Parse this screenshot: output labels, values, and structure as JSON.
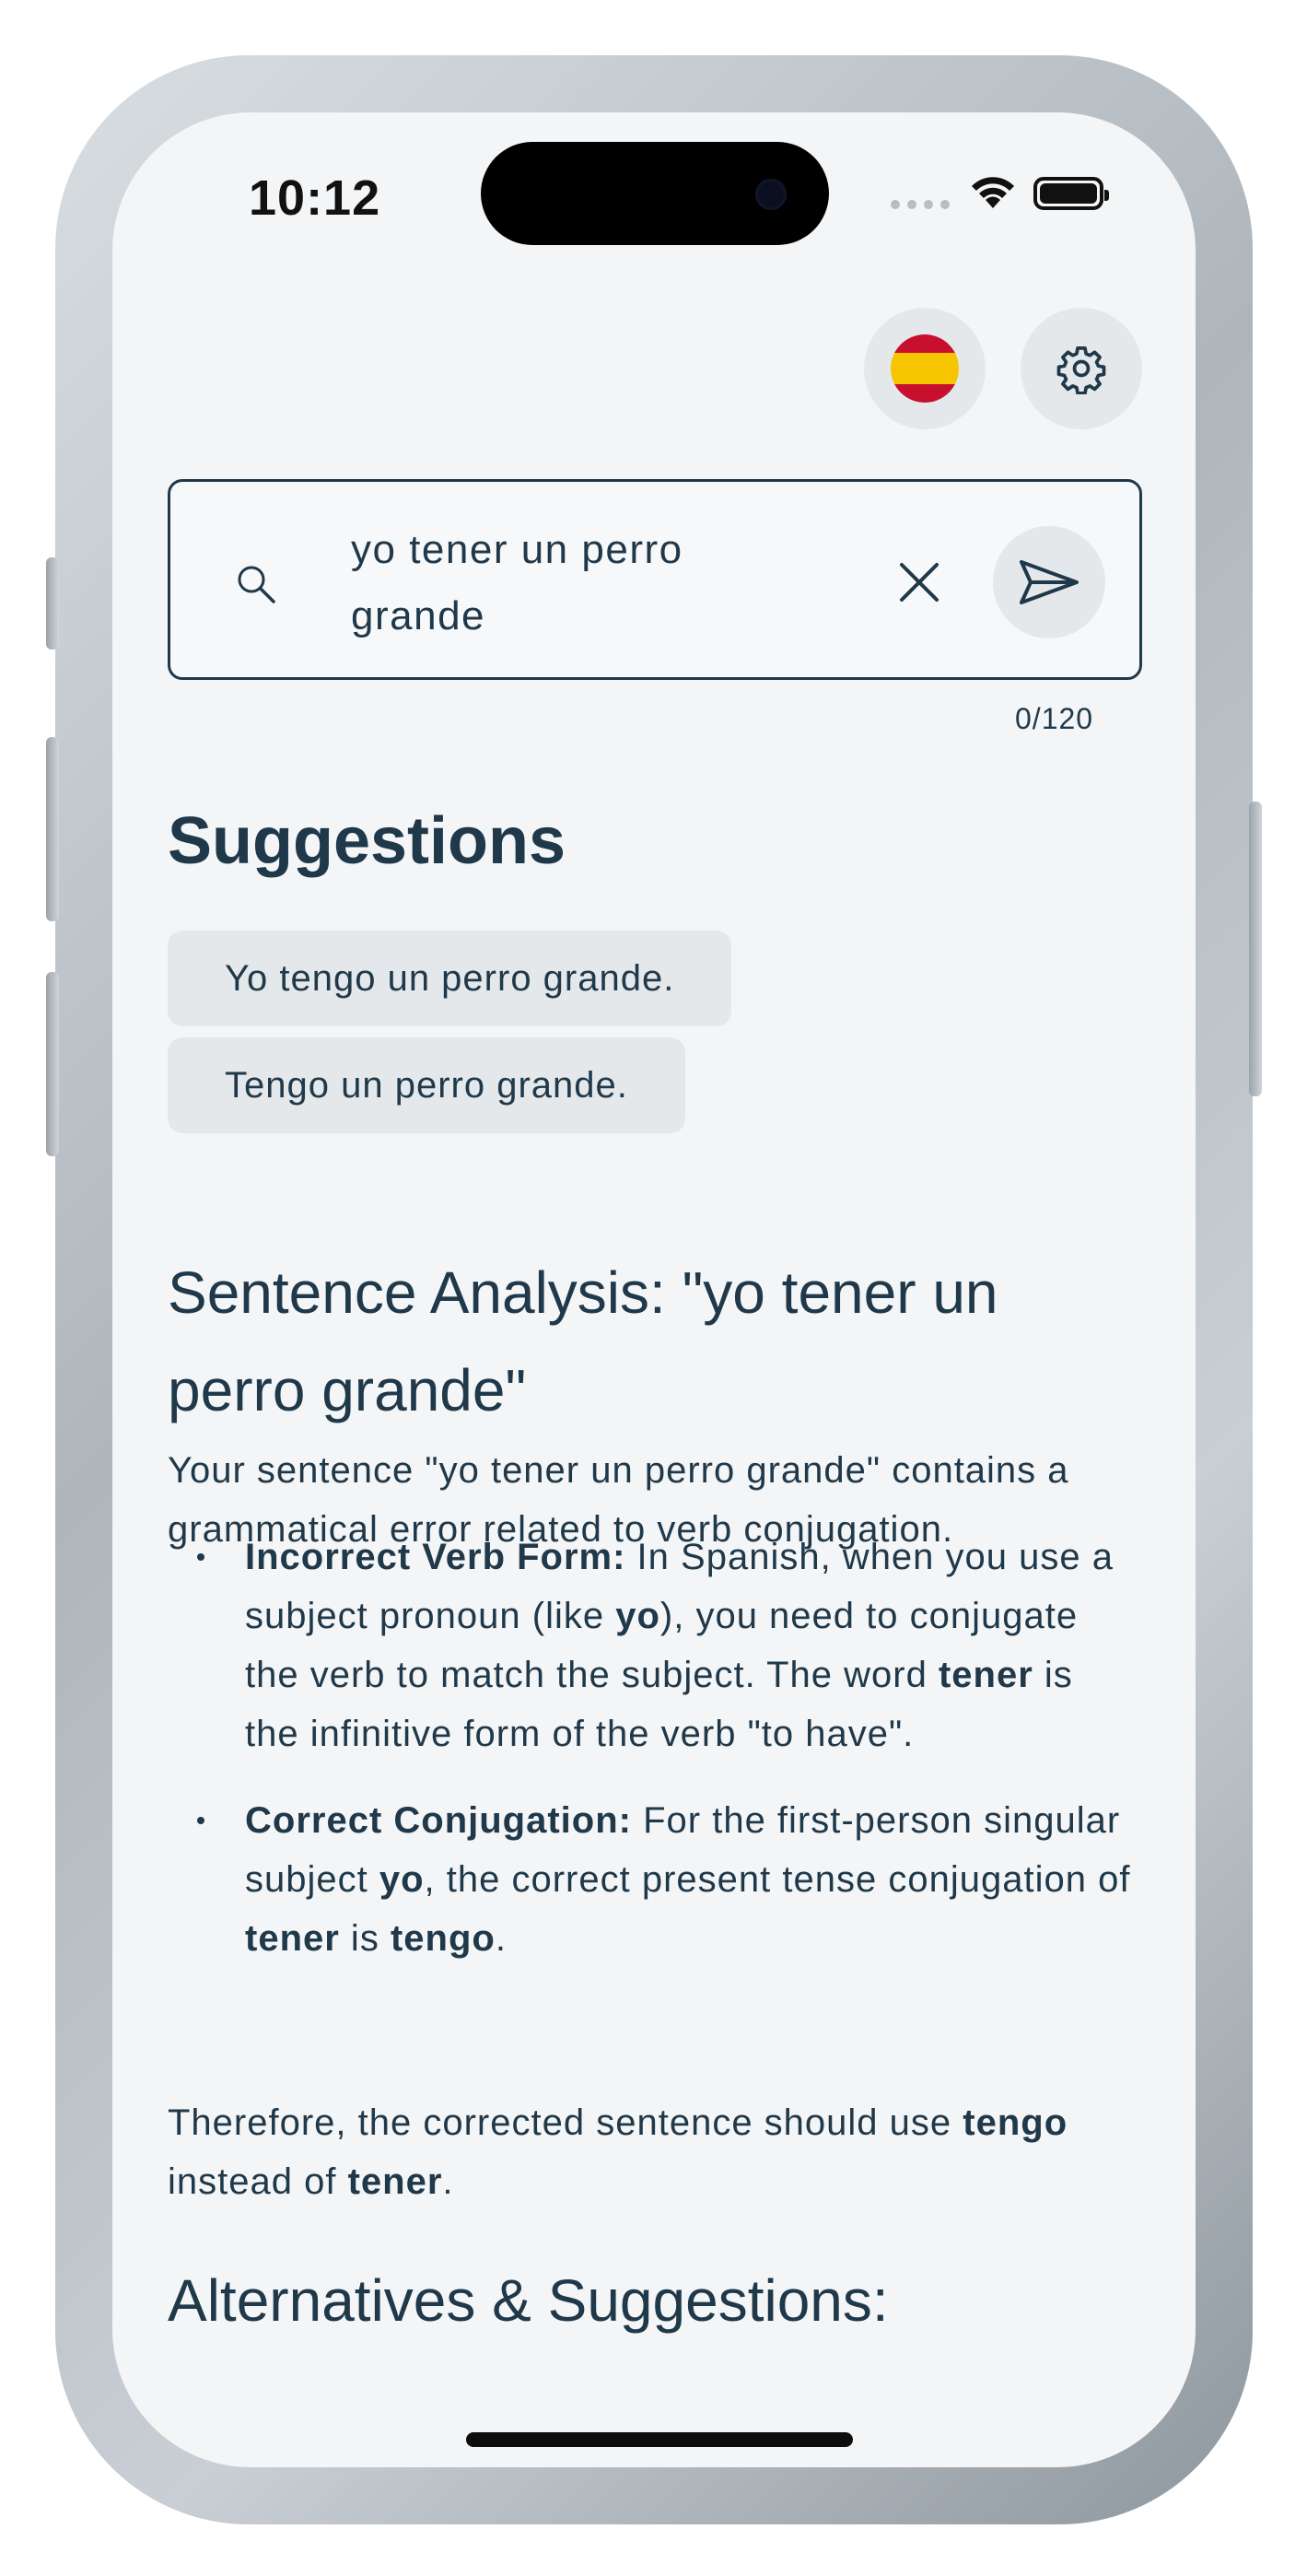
{
  "status_bar": {
    "time": "10:12",
    "wifi_icon": "wifi-icon",
    "battery_icon": "battery-icon"
  },
  "header": {
    "language_flag_icon": "spain-flag-icon",
    "settings_icon": "gear-icon"
  },
  "input": {
    "value_line1": "yo tener un perro",
    "value_line2": "grande",
    "counter": "0/120"
  },
  "suggestions": {
    "title": "Suggestions",
    "items": [
      "Yo tengo un perro grande.",
      "Tengo un perro grande."
    ]
  },
  "analysis": {
    "title_line1": "Sentence Analysis: \"yo tener un",
    "title_line2": "perro grande\"",
    "intro": "Your sentence \"yo tener un perro grande\" contains a grammatical error related to verb conjugation.",
    "bullets": [
      {
        "label": "Incorrect Verb Form:",
        "t1": " In Spanish, when you use a subject pronoun (like ",
        "b1": "yo",
        "t2": "), you need to conjugate the verb to match the subject. The word ",
        "b2": "tener",
        "t3": " is the infinitive form of the verb \"to have\"."
      },
      {
        "label": "Correct Conjugation:",
        "t1": " For the first-person singular subject ",
        "b1": "yo",
        "t2": ", the correct present tense conjugation of ",
        "b2": "tener",
        "t3": " is ",
        "b3": "tengo",
        "t4": "."
      }
    ],
    "conclusion": {
      "t1": "Therefore, the corrected sentence should use ",
      "b1": "tengo",
      "t2": " instead of ",
      "b2": "tener",
      "t3": "."
    }
  },
  "alternatives": {
    "title": "Alternatives & Suggestions:"
  },
  "colors": {
    "text": "#20394a",
    "background": "#f4f5f7",
    "chip_background": "#e5e8eb"
  }
}
